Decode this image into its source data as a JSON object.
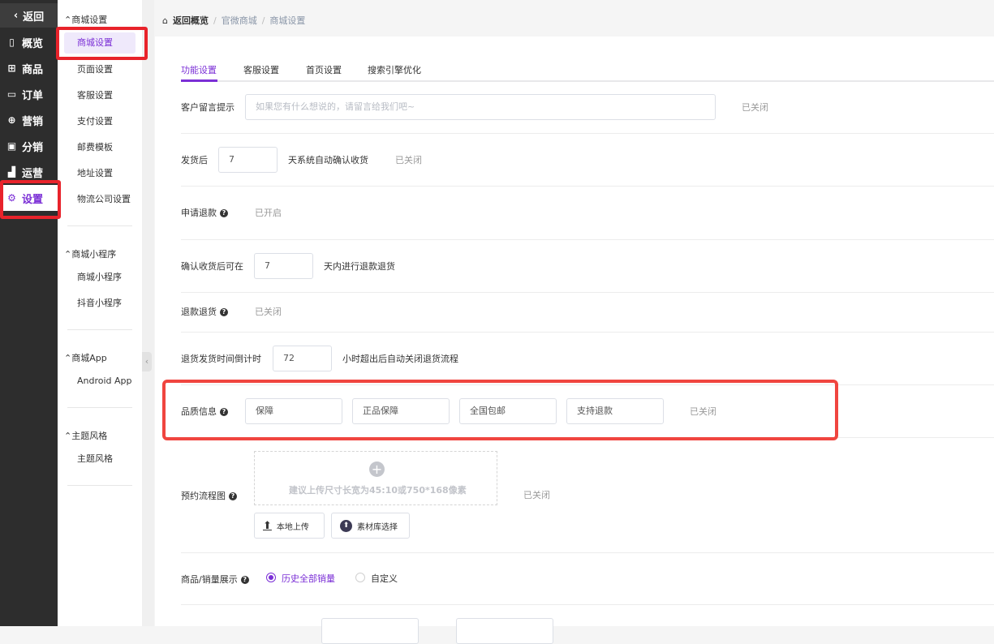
{
  "nav_primary": {
    "back": "返回",
    "items": [
      {
        "label": "概览",
        "icon": "overview-icon"
      },
      {
        "label": "商品",
        "icon": "goods-icon"
      },
      {
        "label": "订单",
        "icon": "order-icon"
      },
      {
        "label": "营销",
        "icon": "marketing-icon"
      },
      {
        "label": "分销",
        "icon": "distribution-icon"
      },
      {
        "label": "运营",
        "icon": "operation-icon"
      },
      {
        "label": "设置",
        "icon": "gear-icon",
        "active": true
      }
    ]
  },
  "nav_secondary": {
    "groups": [
      {
        "title": "商城设置",
        "items": [
          "商城设置",
          "页面设置",
          "客服设置",
          "支付设置",
          "邮费模板",
          "地址设置",
          "物流公司设置"
        ]
      },
      {
        "title": "商城小程序",
        "items": [
          "商城小程序",
          "抖音小程序"
        ]
      },
      {
        "title": "商城App",
        "items": [
          "Android App"
        ]
      },
      {
        "title": "主题风格",
        "items": [
          "主题风格"
        ]
      }
    ]
  },
  "breadcrumb": [
    "返回概览",
    "官微商城",
    "商城设置"
  ],
  "tabs": [
    "功能设置",
    "客服设置",
    "首页设置",
    "搜索引擎优化"
  ],
  "form": {
    "message": {
      "label": "客户留言提示",
      "placeholder": "如果您有什么想说的，请留言给我们吧~",
      "status": "已关闭"
    },
    "auto_confirm": {
      "label": "发货后",
      "value": "7",
      "suffix": "天系统自动确认收货",
      "status": "已关闭"
    },
    "refund_apply": {
      "label": "申请退款",
      "status": "已开启"
    },
    "after_confirm": {
      "label": "确认收货后可在",
      "value": "7",
      "suffix": "天内进行退款退货"
    },
    "refund_return": {
      "label": "退款退货",
      "status": "已关闭"
    },
    "return_countdown": {
      "label": "退货发货时间倒计时",
      "value": "72",
      "suffix": "小时超出后自动关闭退货流程"
    },
    "quality": {
      "label": "品质信息",
      "values": [
        "保障",
        "正品保障",
        "全国包邮",
        "支持退款"
      ],
      "status": "已关闭"
    },
    "flow_image": {
      "label": "预约流程图",
      "tip": "建议上传尺寸长宽为45:10或750*168像素",
      "status": "已关闭",
      "local_upload": "本地上传",
      "library": "素材库选择"
    },
    "sales_display": {
      "label": "商品/销量展示",
      "options": [
        "历史全部销量",
        "自定义"
      ],
      "selected": "历史全部销量"
    }
  },
  "colors": {
    "accent": "#7b2fd6",
    "annotation": "#e8232b"
  }
}
